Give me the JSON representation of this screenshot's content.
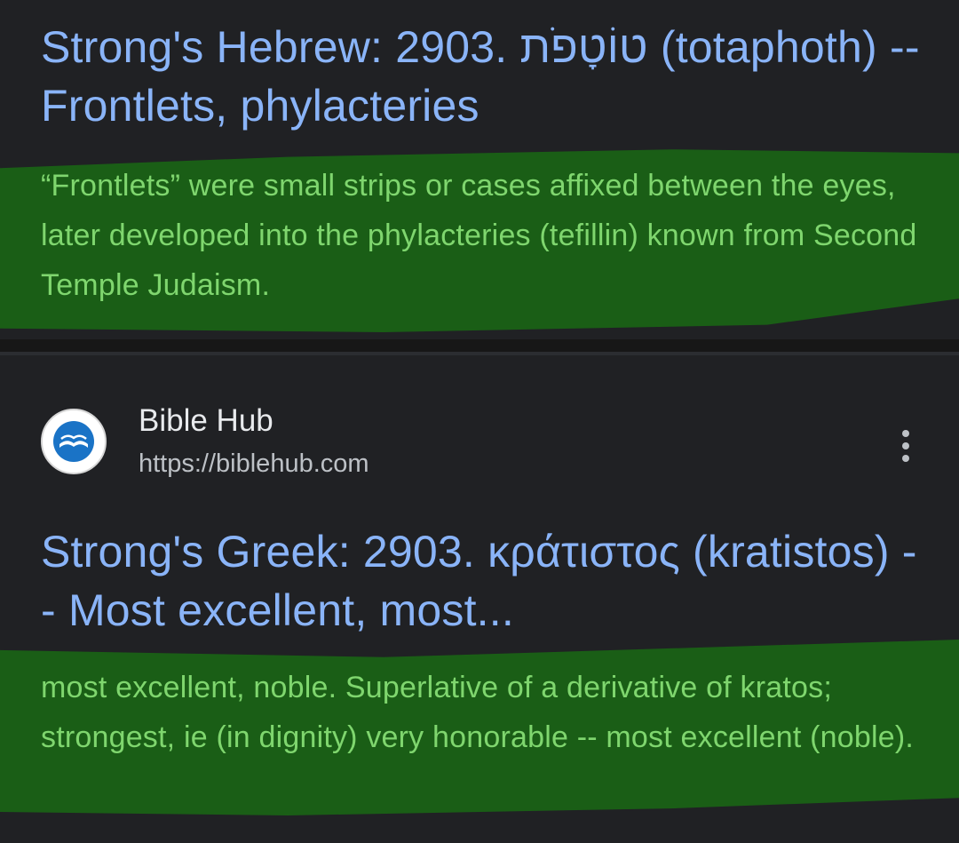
{
  "results": [
    {
      "title": "Strong's Hebrew: 2903. טוֹטָפֹת (totaphoth) -- Frontlets, phylacteries",
      "snippet": "“Frontlets” were small strips or cases affixed between the eyes, later developed into the phylacteries (tefillin) known from Second Temple Judaism."
    },
    {
      "site_name": "Bible Hub",
      "site_url": "https://biblehub.com",
      "favicon": "biblehub-logo-icon",
      "menu_icon": "more-vert-icon",
      "title": "Strong's Greek: 2903. κράτιστος (kratistos) -- Most excellent, most...",
      "snippet": "most excellent, noble. Superlative of a derivative of kratos; strongest, ie (in dignity) very honorable -- most excellent (noble)."
    }
  ],
  "colors": {
    "background": "#202124",
    "title_link": "#8ab4f8",
    "highlight": "#1a5e16",
    "highlight_text": "#7fd66e",
    "site_name": "#e8eaed",
    "site_url": "#bdc1c6"
  }
}
